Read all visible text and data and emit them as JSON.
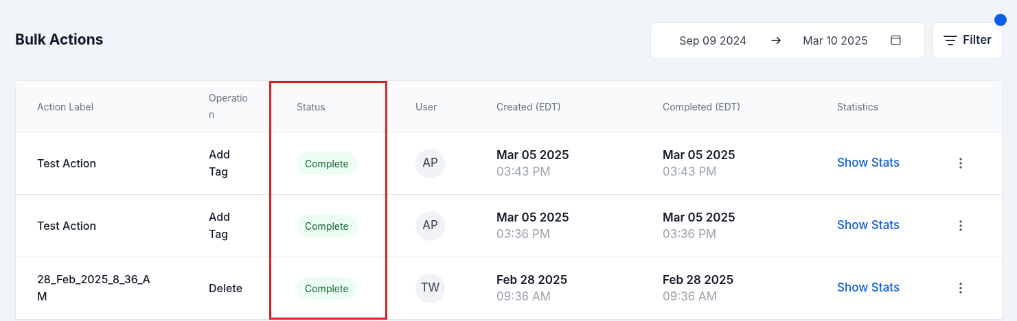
{
  "page": {
    "title": "Bulk Actions"
  },
  "date_range": {
    "start": "Sep 09 2024",
    "end": "Mar 10 2025"
  },
  "filter_button": {
    "label": "Filter",
    "has_indicator": true
  },
  "table": {
    "columns": [
      {
        "label": "Action Label",
        "highlighted": false
      },
      {
        "label": "Operation",
        "highlighted": false
      },
      {
        "label": "Status",
        "highlighted": true
      },
      {
        "label": "User",
        "highlighted": false
      },
      {
        "label": "Created (EDT)",
        "highlighted": false
      },
      {
        "label": "Completed (EDT)",
        "highlighted": false
      },
      {
        "label": "Statistics",
        "highlighted": false
      }
    ],
    "rows": [
      {
        "action_label": "Test Action",
        "operation": "Add Tag",
        "status": "Complete",
        "user": "AP",
        "created_date": "Mar 05 2025",
        "created_time": "03:43 PM",
        "completed_date": "Mar 05 2025",
        "completed_time": "03:43 PM",
        "statistics": "Show Stats"
      },
      {
        "action_label": "Test Action",
        "operation": "Add Tag",
        "status": "Complete",
        "user": "AP",
        "created_date": "Mar 05 2025",
        "created_time": "03:36 PM",
        "completed_date": "Mar 05 2025",
        "completed_time": "03:36 PM",
        "statistics": "Show Stats"
      },
      {
        "action_label": "28_Feb_2025_8_36_AM",
        "operation": "Delete",
        "status": "Complete",
        "user": "TW",
        "created_date": "Feb 28 2025",
        "created_time": "09:36 AM",
        "completed_date": "Feb 28 2025",
        "completed_time": "09:36 AM",
        "statistics": "Show Stats"
      }
    ]
  }
}
